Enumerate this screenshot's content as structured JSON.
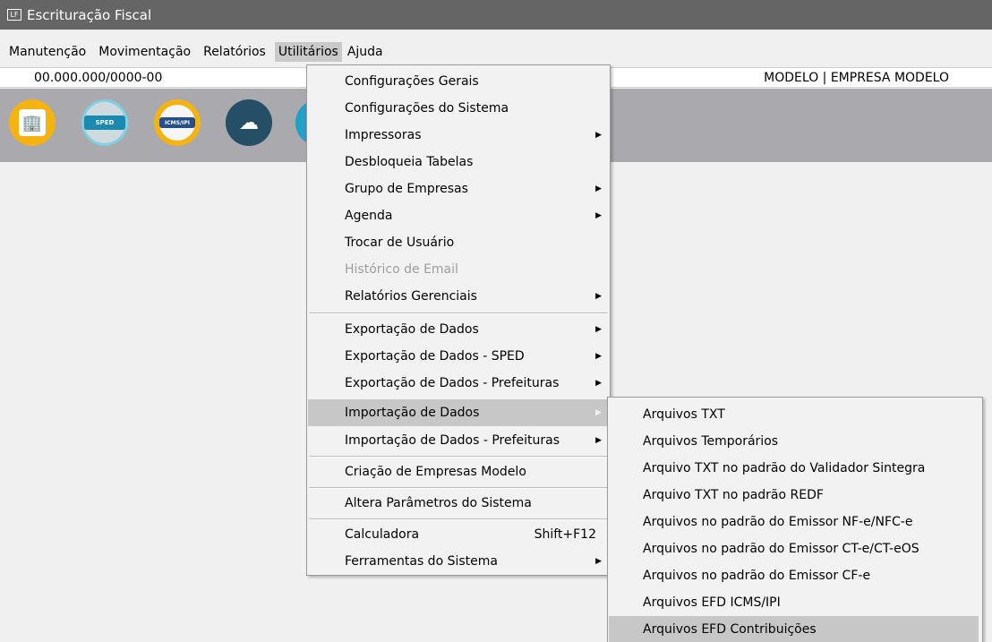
{
  "window": {
    "title": "Escrituração Fiscal",
    "icon_text": "LF"
  },
  "menubar": {
    "items": [
      "Manutenção",
      "Movimentação",
      "Relatórios",
      "Utilitários",
      "Ajuda"
    ]
  },
  "infobar": {
    "cnpj": "00.000.000/0000-00",
    "empresa": "MODELO | EMPRESA MODELO"
  },
  "toolbar": {
    "icons": [
      "building-icon",
      "sped-contribuicoes-icon",
      "icms-ipi-icon",
      "cloud-xml-icon",
      "partial-icon"
    ],
    "sped_text": "SPED",
    "icms_text": "ICMS/IPI",
    "building_glyph": "🏢",
    "cloud_glyph": "☁"
  },
  "utilitarios_menu": {
    "items": [
      {
        "label": "Configurações Gerais"
      },
      {
        "label": "Configurações do Sistema"
      },
      {
        "label": "Impressoras",
        "arrow": "▶"
      },
      {
        "label": "Desbloqueia Tabelas"
      },
      {
        "label": "Grupo de Empresas",
        "arrow": "▶"
      },
      {
        "label": "Agenda",
        "arrow": "▶"
      },
      {
        "label": "Trocar de Usuário"
      },
      {
        "label": "Histórico de Email",
        "disabled": true
      },
      {
        "label": "Relatórios Gerenciais",
        "arrow": "▶"
      },
      {
        "label": "Exportação de Dados",
        "arrow": "▶"
      },
      {
        "label": "Exportação de Dados - SPED",
        "arrow": "▶"
      },
      {
        "label": "Exportação de Dados - Prefeituras",
        "arrow": "▶"
      },
      {
        "label": "Importação de Dados",
        "arrow": "▶",
        "highlighted": true
      },
      {
        "label": "Importação de Dados - Prefeituras",
        "arrow": "▶"
      },
      {
        "label": "Criação de Empresas Modelo"
      },
      {
        "label": "Altera Parâmetros do Sistema"
      },
      {
        "label": "Calculadora",
        "shortcut": "Shift+F12"
      },
      {
        "label": "Ferramentas do Sistema",
        "arrow": "▶"
      }
    ]
  },
  "importacao_submenu": {
    "items": [
      {
        "label": "Arquivos TXT"
      },
      {
        "label": "Arquivos Temporários"
      },
      {
        "label": "Arquivo TXT no padrão do Validador Sintegra"
      },
      {
        "label": "Arquivo TXT no padrão REDF"
      },
      {
        "label": "Arquivos no padrão do Emissor NF-e/NFC-e"
      },
      {
        "label": "Arquivos no padrão do Emissor CT-e/CT-eOS"
      },
      {
        "label": "Arquivos no padrão do Emissor CF-e"
      },
      {
        "label": "Arquivos EFD ICMS/IPI"
      },
      {
        "label": "Arquivos EFD Contribuições",
        "highlighted": true
      }
    ]
  },
  "colors": {
    "titlebar": "#656565",
    "toolbar": "#aaa9ad",
    "menu_bg": "#f2f2f2",
    "highlight": "#c7c7c7"
  }
}
